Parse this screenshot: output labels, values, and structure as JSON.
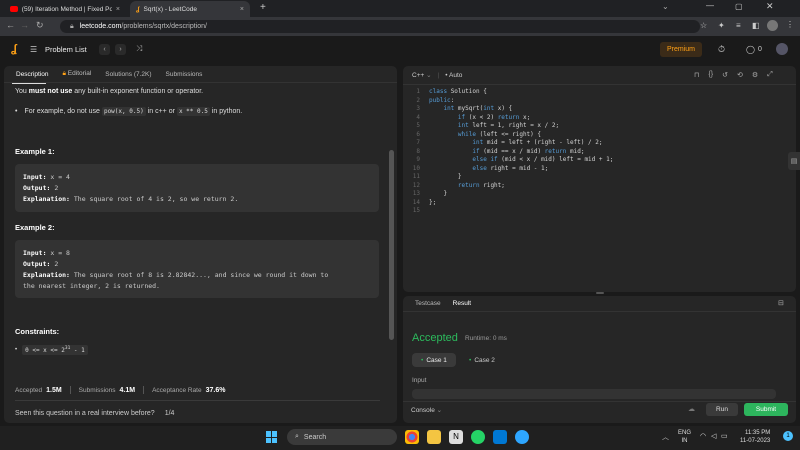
{
  "browser": {
    "tabs": [
      {
        "title": "(59) Iteration Method | Fixed Poi",
        "close": "×"
      },
      {
        "title": "Sqrt(x) - LeetCode",
        "close": "×"
      }
    ],
    "new_tab": "+",
    "url_host": "leetcode.com",
    "url_path": "/problems/sqrtx/description/"
  },
  "nav": {
    "problem_list": "Problem List",
    "premium": "Premium",
    "coins": "0"
  },
  "left": {
    "tabs": [
      "Description",
      "Editorial",
      "Solutions (7.2K)",
      "Submissions"
    ],
    "intro_pre": "You ",
    "intro_bold": "must not use",
    "intro_post": " any built-in exponent function or operator.",
    "bullet_pre": "For example, do not use ",
    "bullet_code1": "pow(x, 0.5)",
    "bullet_mid": " in c++ or ",
    "bullet_code2": "x ** 0.5",
    "bullet_post": " in python.",
    "ex1_title": "Example 1:",
    "ex1_lines": [
      {
        "k": "Input:",
        "v": " x = 4"
      },
      {
        "k": "Output:",
        "v": " 2"
      },
      {
        "k": "Explanation:",
        "v": " The square root of 4 is 2, so we return 2."
      }
    ],
    "ex2_title": "Example 2:",
    "ex2_lines": [
      {
        "k": "Input:",
        "v": " x = 8"
      },
      {
        "k": "Output:",
        "v": " 2"
      },
      {
        "k": "Explanation:",
        "v": " The square root of 8 is 2.82842..., and since we round it down to"
      },
      {
        "k": "",
        "v": "the nearest integer, 2 is returned."
      }
    ],
    "constraints_title": "Constraints:",
    "constraint_base": "0 <= x <= 2",
    "constraint_exp": "31",
    "constraint_tail": " - 1",
    "stats": {
      "accepted_label": "Accepted",
      "accepted": "1.5M",
      "submissions_label": "Submissions",
      "submissions": "4.1M",
      "rate_label": "Acceptance Rate",
      "rate": "37.6%"
    },
    "interview_q": "Seen this question in a real interview before?",
    "interview_count": "1/4"
  },
  "editor": {
    "language": "C++",
    "mode": "Auto",
    "lines": [
      "class Solution {",
      "public:",
      "    int mySqrt(int x) {",
      "        if (x < 2) return x;",
      "        int left = 1, right = x / 2;",
      "        while (left <= right) {",
      "            int mid = left + (right - left) / 2;",
      "            if (mid == x / mid) return mid;",
      "            else if (mid < x / mid) left = mid + 1;",
      "            else right = mid - 1;",
      "        }",
      "        return right;",
      "    }",
      "};",
      ""
    ]
  },
  "result": {
    "tabs": [
      "Testcase",
      "Result"
    ],
    "status": "Accepted",
    "runtime": "Runtime: 0 ms",
    "cases": [
      "Case 1",
      "Case 2"
    ],
    "input_label": "Input",
    "console": "Console",
    "run": "Run",
    "submit": "Submit"
  },
  "taskbar": {
    "search": "Search",
    "lang1": "ENG",
    "lang2": "IN",
    "time": "11:35 PM",
    "date": "11-07-2023"
  },
  "colors": {
    "accent": "#ffa116",
    "green": "#2cbb5d",
    "submit": "#2db55d"
  }
}
